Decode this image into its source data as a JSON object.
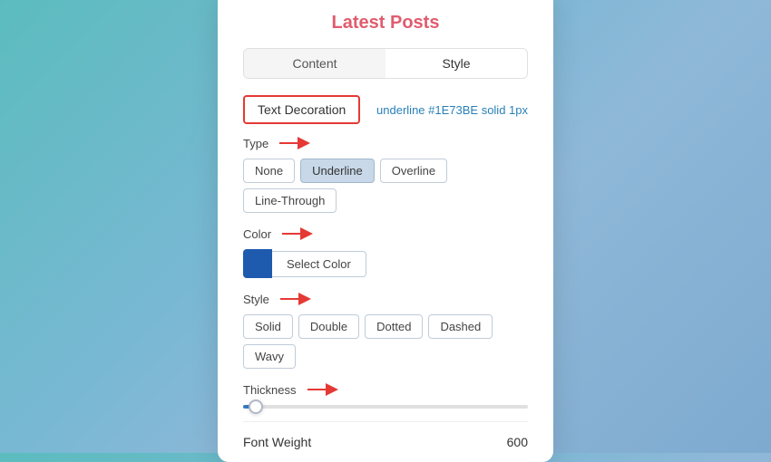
{
  "panel": {
    "title": "Latest Posts",
    "tabs": [
      {
        "id": "content",
        "label": "Content",
        "active": false
      },
      {
        "id": "style",
        "label": "Style",
        "active": true
      }
    ],
    "textDecoration": {
      "label": "Text Decoration",
      "value": "underline #1E73BE solid 1px"
    },
    "type": {
      "label": "Type",
      "options": [
        {
          "id": "none",
          "label": "None",
          "active": false
        },
        {
          "id": "underline",
          "label": "Underline",
          "active": true
        },
        {
          "id": "overline",
          "label": "Overline",
          "active": false
        },
        {
          "id": "line-through",
          "label": "Line-Through",
          "active": false
        }
      ]
    },
    "color": {
      "label": "Color",
      "swatch": "#1E5BAF",
      "button_label": "Select Color"
    },
    "style": {
      "label": "Style",
      "options": [
        {
          "id": "solid",
          "label": "Solid",
          "active": false
        },
        {
          "id": "double",
          "label": "Double",
          "active": false
        },
        {
          "id": "dotted",
          "label": "Dotted",
          "active": false
        },
        {
          "id": "dashed",
          "label": "Dashed",
          "active": false
        },
        {
          "id": "wavy",
          "label": "Wavy",
          "active": false
        }
      ]
    },
    "thickness": {
      "label": "Thickness",
      "value": 1
    },
    "fontWeight": {
      "label": "Font Weight",
      "value": "600"
    }
  }
}
